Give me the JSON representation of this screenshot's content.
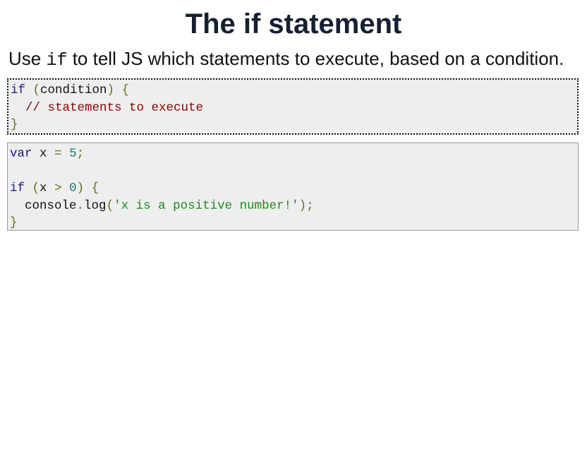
{
  "slide": {
    "title": "The if statement",
    "intro": {
      "before": "Use ",
      "code": "if",
      "after": " to tell JS which statements to execute, based on a condition."
    },
    "syntax_block": {
      "line1": {
        "kw": "if",
        "p1": " (",
        "cond": "condition",
        "p2": ") {"
      },
      "line2": {
        "indent": "  ",
        "comment": "// statements to execute"
      },
      "line3": {
        "brace": "}"
      }
    },
    "example_block": {
      "line1": {
        "kw": "var",
        "name": " x ",
        "eq": "=",
        "sp": " ",
        "num": "5",
        "semi": ";"
      },
      "line3": {
        "kw": "if",
        "sp": " ",
        "p1": "(",
        "x": "x",
        "gt": " > ",
        "num": "0",
        "p2": ")",
        "brace": " {"
      },
      "line4": {
        "indent": "  ",
        "obj": "console",
        "dot": ".",
        "fn": "log",
        "p1": "(",
        "str": "'x is a positive number!'",
        "p2": ");"
      },
      "line5": {
        "brace": "}"
      }
    }
  }
}
